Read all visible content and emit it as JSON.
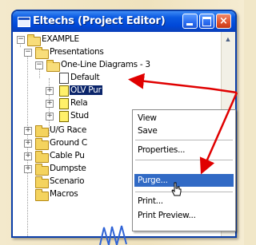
{
  "window": {
    "title": "Eltechs (Project Editor)",
    "title_icon": "app-window-icon",
    "buttons": {
      "minimize": "minimize-icon",
      "maximize": "maximize-icon",
      "close": "×"
    }
  },
  "tree": {
    "root": "EXAMPLE",
    "presentations": "Presentations",
    "one_line_folder": "One-Line Diagrams - 3",
    "items": {
      "default": "Default",
      "olv": "OLV Pur",
      "rela": "Rela",
      "stud": "Stud",
      "ug_race": "U/G Race",
      "ground": "Ground C",
      "cable": "Cable Pu",
      "dumpster": "Dumpste",
      "scenario": "Scenario",
      "macros": "Macros"
    }
  },
  "context_menu": {
    "view": "View",
    "save": "Save",
    "properties": "Properties...",
    "purge": "Purge...",
    "print": "Print...",
    "print_preview": "Print Preview..."
  },
  "colors": {
    "titlebar": "#0048d8",
    "selection": "#0a246a",
    "menu_highlight": "#316ac5",
    "annotation_arrow": "#e00000",
    "waveform": "#2f63d6"
  }
}
